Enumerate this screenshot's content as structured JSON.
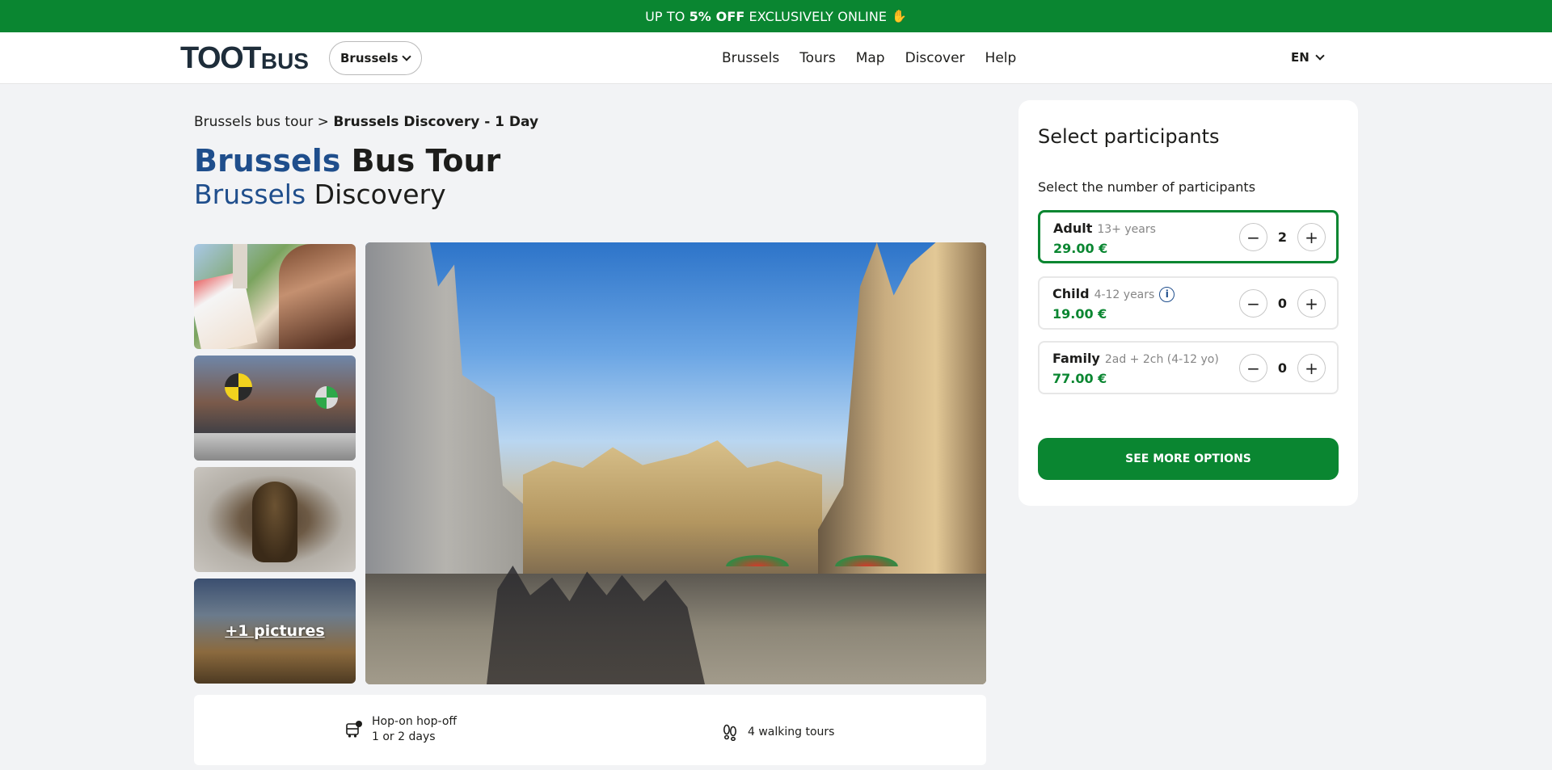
{
  "promo": {
    "prefix": "UP TO ",
    "bold": "5% OFF",
    "suffix": " EXCLUSIVELY ONLINE",
    "icon": "✋"
  },
  "header": {
    "logo_big": "TOOT",
    "logo_small": "BUS",
    "city_select": "Brussels",
    "nav": [
      "Brussels",
      "Tours",
      "Map",
      "Discover",
      "Help"
    ],
    "language": "EN"
  },
  "breadcrumb": {
    "parent": "Brussels bus tour",
    "separator": ">",
    "current": "Brussels Discovery - 1 Day"
  },
  "title": {
    "city": "Brussels",
    "rest": "Bus Tour"
  },
  "subtitle": {
    "city": "Brussels",
    "rest": "Discovery"
  },
  "gallery": {
    "more_pictures": "+1 pictures"
  },
  "features": [
    {
      "icon": "bus-icon",
      "line1": "Hop-on hop-off",
      "line2": "1 or 2 days"
    },
    {
      "icon": "footprints-icon",
      "line1": "4 walking tours"
    }
  ],
  "booking": {
    "heading": "Select participants",
    "label": "Select the number of participants",
    "participants": [
      {
        "name": "Adult",
        "age": "13+ years",
        "price": "29.00 €",
        "qty": "2"
      },
      {
        "name": "Child",
        "age": "4-12 years",
        "price": "19.00 €",
        "qty": "0"
      },
      {
        "name": "Family",
        "age": "2ad + 2ch (4-12 yo)",
        "price": "77.00 €",
        "qty": "0"
      }
    ],
    "cta": "SEE MORE OPTIONS"
  },
  "colors": {
    "brand_green": "#0a8631",
    "title_blue": "#1f4e8c"
  }
}
